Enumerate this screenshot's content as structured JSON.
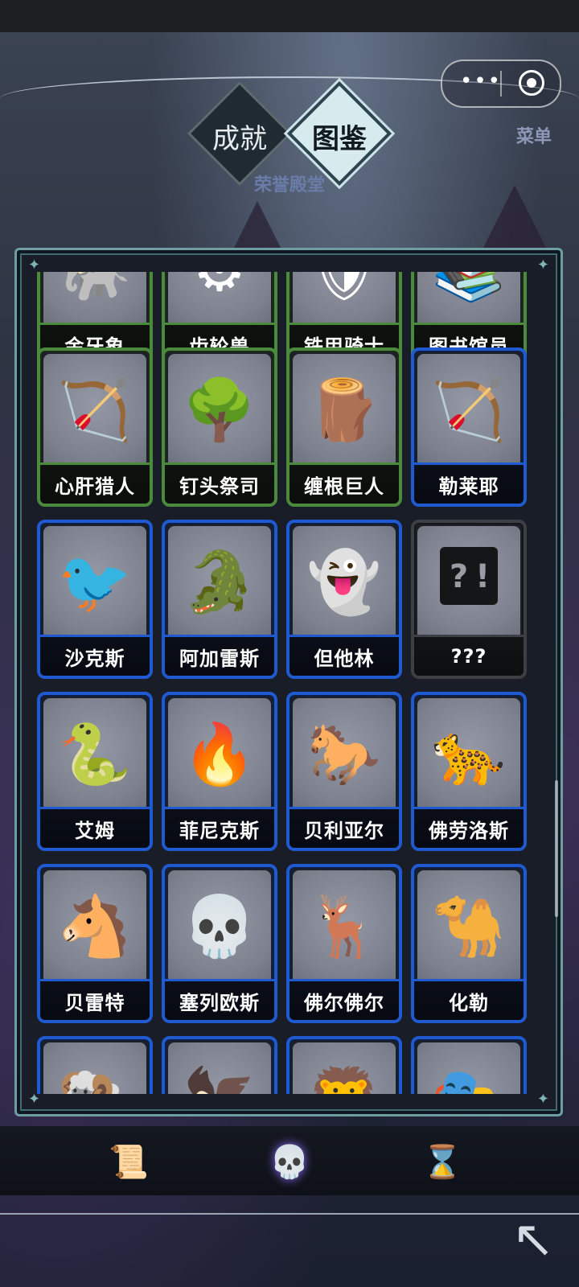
{
  "capsule": {
    "more_glyph": "•••",
    "close_glyph": "◉"
  },
  "header": {
    "menu_label": "菜单",
    "tabs": [
      {
        "label": "成就",
        "active": false
      },
      {
        "label": "图鉴",
        "active": true
      }
    ],
    "subtitle": "荣誉殿堂"
  },
  "colors": {
    "uncommon_border": "#4b8a3c",
    "rare_border": "#1f5ad0",
    "locked_border": "#3d3f44",
    "panel_border": "#6c9ea2"
  },
  "codex": {
    "rows": [
      [
        {
          "name": "金牙象",
          "rarity": "green",
          "icon": "elephant-icon",
          "glyph": "🐘"
        },
        {
          "name": "齿轮兽",
          "rarity": "green",
          "icon": "gear-beast-icon",
          "glyph": "⚙"
        },
        {
          "name": "铁甲骑士",
          "rarity": "green",
          "icon": "knight-icon",
          "glyph": "🛡"
        },
        {
          "name": "图书馆员",
          "rarity": "green",
          "icon": "librarian-icon",
          "glyph": "📚"
        }
      ],
      [
        {
          "name": "心肝猎人",
          "rarity": "green",
          "icon": "hunter-icon",
          "glyph": "🏹"
        },
        {
          "name": "钉头祭司",
          "rarity": "green",
          "icon": "tree-priest-icon",
          "glyph": "🌳"
        },
        {
          "name": "缠根巨人",
          "rarity": "green",
          "icon": "root-giant-icon",
          "glyph": "🪵"
        },
        {
          "name": "勒莱耶",
          "rarity": "blue",
          "icon": "archer-icon",
          "glyph": "🏹"
        }
      ],
      [
        {
          "name": "沙克斯",
          "rarity": "blue",
          "icon": "raven-icon",
          "glyph": "🐦"
        },
        {
          "name": "阿加雷斯",
          "rarity": "blue",
          "icon": "crocodile-rider-icon",
          "glyph": "🐊"
        },
        {
          "name": "但他林",
          "rarity": "blue",
          "icon": "shadow-spirit-icon",
          "glyph": "👻"
        },
        {
          "name": "???",
          "rarity": "gray",
          "icon": "mystery-box-icon",
          "glyph": ""
        }
      ],
      [
        {
          "name": "艾姆",
          "rarity": "blue",
          "icon": "fire-serpent-icon",
          "glyph": "🐍"
        },
        {
          "name": "菲尼克斯",
          "rarity": "blue",
          "icon": "phoenix-icon",
          "glyph": "🔥"
        },
        {
          "name": "贝利亚尔",
          "rarity": "blue",
          "icon": "fire-chariot-icon",
          "glyph": "🐎"
        },
        {
          "name": "佛劳洛斯",
          "rarity": "blue",
          "icon": "flame-panther-icon",
          "glyph": "🐆"
        }
      ],
      [
        {
          "name": "贝雷特",
          "rarity": "blue",
          "icon": "horse-rider-icon",
          "glyph": "🐴"
        },
        {
          "name": "塞列欧斯",
          "rarity": "blue",
          "icon": "skeleton-rider-icon",
          "glyph": "💀"
        },
        {
          "name": "佛尔佛尔",
          "rarity": "blue",
          "icon": "winged-stag-icon",
          "glyph": "🦌"
        },
        {
          "name": "化勒",
          "rarity": "blue",
          "icon": "camel-rider-icon",
          "glyph": "🐪"
        }
      ],
      [
        {
          "name": "",
          "rarity": "blue",
          "icon": "ram-horn-elder-icon",
          "glyph": "🐏"
        },
        {
          "name": "",
          "rarity": "blue",
          "icon": "dark-crow-icon",
          "glyph": "🦅"
        },
        {
          "name": "",
          "rarity": "blue",
          "icon": "lion-sword-icon",
          "glyph": "🦁"
        },
        {
          "name": "",
          "rarity": "blue",
          "icon": "plague-doctor-icon",
          "glyph": "🎭"
        }
      ]
    ]
  },
  "bottom_nav": {
    "items": [
      {
        "icon": "scroll-icon",
        "glyph": "📜",
        "active": false
      },
      {
        "icon": "skull-icon",
        "glyph": "💀",
        "active": true
      },
      {
        "icon": "hourglass-icon",
        "glyph": "⌛",
        "active": false
      }
    ],
    "corner_arrow": "↖"
  }
}
